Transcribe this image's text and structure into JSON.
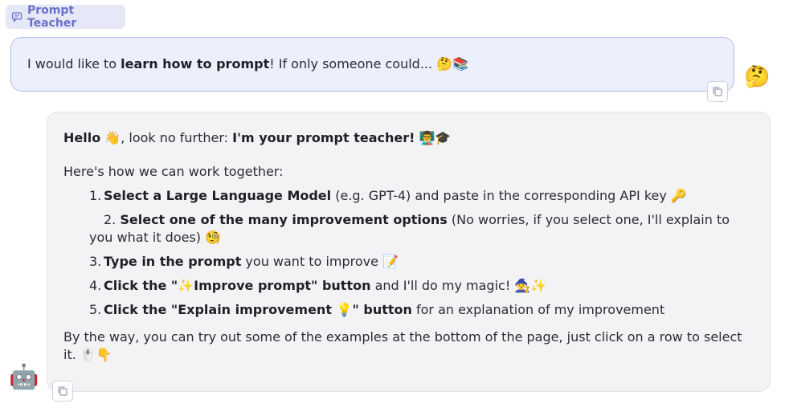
{
  "header": {
    "chip_label": "Prompt Teacher",
    "chip_icon": "chat-bubble-icon"
  },
  "user_message": {
    "part1": "I would like to ",
    "bold": "learn how to prompt",
    "part2": "! If only someone could... 🤔📚",
    "avatar": "🤔"
  },
  "bot_message": {
    "hello_bold": "Hello",
    "hello_rest": " 👋, look no further: ",
    "teacher_bold": "I'm your prompt teacher!",
    "teacher_emoji": " 👨‍🏫🎓",
    "intro": "Here's how we can work together:",
    "steps": [
      {
        "num": "1.",
        "bold": "Select a Large Language Model",
        "rest": " (e.g. GPT-4) and paste in the corresponding API key 🔑"
      },
      {
        "num": "2.",
        "bold": "Select one of the many improvement options",
        "rest": " (No worries, if you select one, I'll explain to you what it does) 🧐"
      },
      {
        "num": "3.",
        "bold": "Type in the prompt",
        "rest": " you want to improve 📝"
      },
      {
        "num": "4.",
        "bold": "Click the \"✨Improve prompt\" button",
        "rest": " and I'll do my magic! 🧙✨"
      },
      {
        "num": "5.",
        "bold": "Click the \"Explain improvement 💡\" button",
        "rest": " for an explanation of my improvement"
      }
    ],
    "outro": "By the way, you can try out some of the examples at the bottom of the page, just click on a row to select it. 🖱️👇",
    "avatar": "🤖"
  },
  "icons": {
    "copy": "copy-icon"
  }
}
